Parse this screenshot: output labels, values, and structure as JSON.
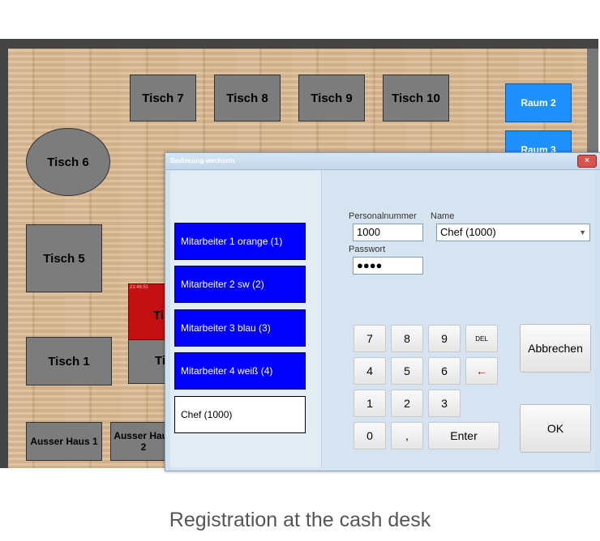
{
  "floor_plan": {
    "tables": {
      "t7": "Tisch 7",
      "t8": "Tisch 8",
      "t9": "Tisch 9",
      "t10": "Tisch 10",
      "t6": "Tisch 6",
      "t5": "Tisch 5",
      "t1": "Tisch 1",
      "t_partial_1": "Ti",
      "t_red": "Ti",
      "ausser1": "Ausser Haus 1",
      "ausser2": "Ausser Haus 2"
    },
    "red_table_label": "21:46:51",
    "rooms": {
      "raum2": "Raum 2",
      "raum3": "Raum 3"
    }
  },
  "dialog": {
    "title": "Bedienung wechseln",
    "close": "×",
    "employees": [
      "Mitarbeiter 1 orange (1)",
      "Mitarbeiter 2 sw (2)",
      "Mitarbeiter 3 blau (3)",
      "Mitarbeiter 4 weiß (4)",
      "Chef (1000)"
    ],
    "personalnummer_label": "Personalnummer",
    "personalnummer_value": "1000",
    "name_label": "Name",
    "name_value": "Chef (1000)",
    "passwort_label": "Passwort",
    "passwort_value": "●●●●",
    "keypad": {
      "k7": "7",
      "k8": "8",
      "k9": "9",
      "del": "DEL",
      "k4": "4",
      "k5": "5",
      "k6": "6",
      "back": "←",
      "k1": "1",
      "k2": "2",
      "k3": "3",
      "k0": "0",
      "comma": ",",
      "enter": "Enter"
    },
    "cancel": "Abbrechen",
    "ok": "OK"
  },
  "caption": "Registration at the cash desk",
  "colors": {
    "employee_blue": "#0000ff",
    "room_blue": "#1e90ff",
    "occupied_red": "#c41010"
  }
}
